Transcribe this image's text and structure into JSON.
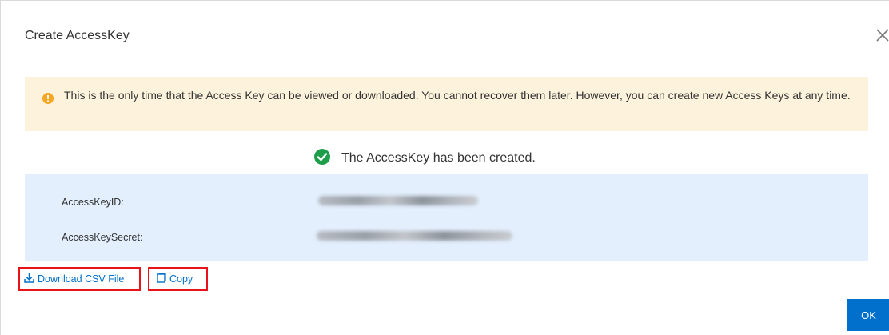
{
  "dialog": {
    "title": "Create AccessKey",
    "close_icon": "close-icon"
  },
  "alert": {
    "icon": "warning-circle-icon",
    "text": "This is the only time that the Access Key can be viewed or downloaded. You cannot recover them later. However, you can create new Access Keys at any time."
  },
  "status": {
    "icon": "check-circle-icon",
    "text": "The AccessKey has been created."
  },
  "credentials": {
    "id_label": "AccessKeyID:",
    "secret_label": "AccessKeySecret:"
  },
  "actions": {
    "download_label": "Download CSV File",
    "download_icon": "download-icon",
    "copy_label": "Copy",
    "copy_icon": "copy-icon",
    "ok_label": "OK"
  },
  "colors": {
    "accent": "#0070cc",
    "alert_bg": "#fdf3dc",
    "panel_bg": "#e3effd",
    "success": "#1e9e4b",
    "warning": "#f5a623",
    "highlight_border": "#e8141a"
  }
}
